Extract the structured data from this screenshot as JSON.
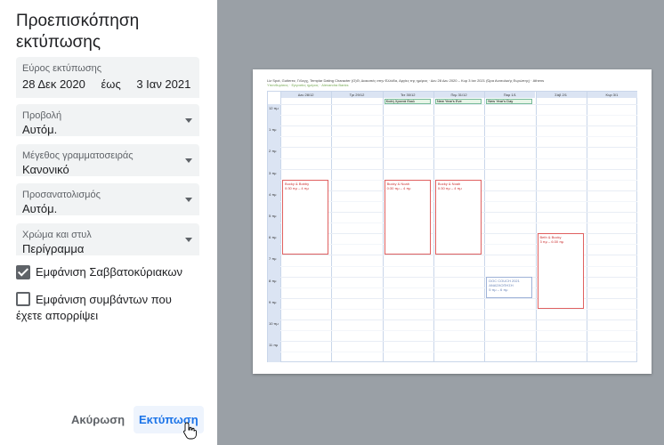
{
  "panel": {
    "title": "Προεπισκόπηση εκτύπωσης",
    "range": {
      "label": "Εύρος εκτύπωσης",
      "from": "28 Δεκ 2020",
      "sep": "έως",
      "to": "3 Ιαν 2021"
    },
    "view": {
      "label": "Προβολή",
      "value": "Αυτόμ."
    },
    "font_size": {
      "label": "Μέγεθος γραμματοσειράς",
      "value": "Κανονικό"
    },
    "orientation": {
      "label": "Προσανατολισμός",
      "value": "Αυτόμ."
    },
    "color_style": {
      "label": "Χρώμα και στυλ",
      "value": "Περίγραμμα"
    },
    "show_weekends": {
      "label": "Εμφάνιση Σαββατοκύριακων",
      "checked": true
    },
    "show_declined": {
      "label": "Εμφάνιση συμβάντων που έχετε απορρίψει",
      "checked": false
    },
    "cancel_label": "Ακύρωση",
    "print_label": "Εκτύπωση"
  },
  "preview": {
    "legend_line1": "Liz Spot, Gutierez, Γέλεγχ, Templar Dating Character (Ο)Θ, Διακοπές στην Ελλάδα, Αργίες της ημέρας · Δευ 28 Δευ 2020 – Κυρ 3 Ιαν 2021 (Ώρα Ανατολικής Ευρώπης) · Athens",
    "legend_line2": "Υπενθυμίσεις · Εργασίες ημέρας · Alexandra Banks",
    "days": [
      "Δευ 28/12",
      "Τρι 29/12",
      "Τετ 30/12",
      "Πεμ 31/12",
      "Παρ 1/1",
      "Σάβ 2/1",
      "Κυρ 3/1"
    ],
    "allday": [
      {
        "day": 2,
        "text": "Καλή Χρονιά Εκκλ"
      },
      {
        "day": 3,
        "text": "New Year's Eve"
      },
      {
        "day": 4,
        "text": "New Year's Day"
      }
    ],
    "hours": [
      "12 πμ",
      "1 πμ",
      "2 πμ",
      "3 πμ",
      "4 πμ",
      "5 πμ",
      "6 πμ",
      "7 πμ",
      "8 πμ",
      "9 πμ",
      "10 πμ",
      "11 πμ"
    ],
    "events": [
      {
        "day": 0,
        "title": "Bucky & Bobby",
        "time": "0:30 πμ – 4 πμ"
      },
      {
        "day": 2,
        "title": "Bucky & Noah",
        "time": "0:30 πμ – 4 πμ"
      },
      {
        "day": 3,
        "title": "Bucky & Noah",
        "time": "0:30 πμ – 4 πμ"
      },
      {
        "day": 4,
        "title": "DOC COUCH 2021 ΑΝΑΣΚΟΠΗΣΗ",
        "time": "5 πμ – 6 πμ",
        "style": "blue"
      },
      {
        "day": 5,
        "title": "Beth & Bucky",
        "time": "3 πμ – 6:30 πμ"
      }
    ]
  }
}
